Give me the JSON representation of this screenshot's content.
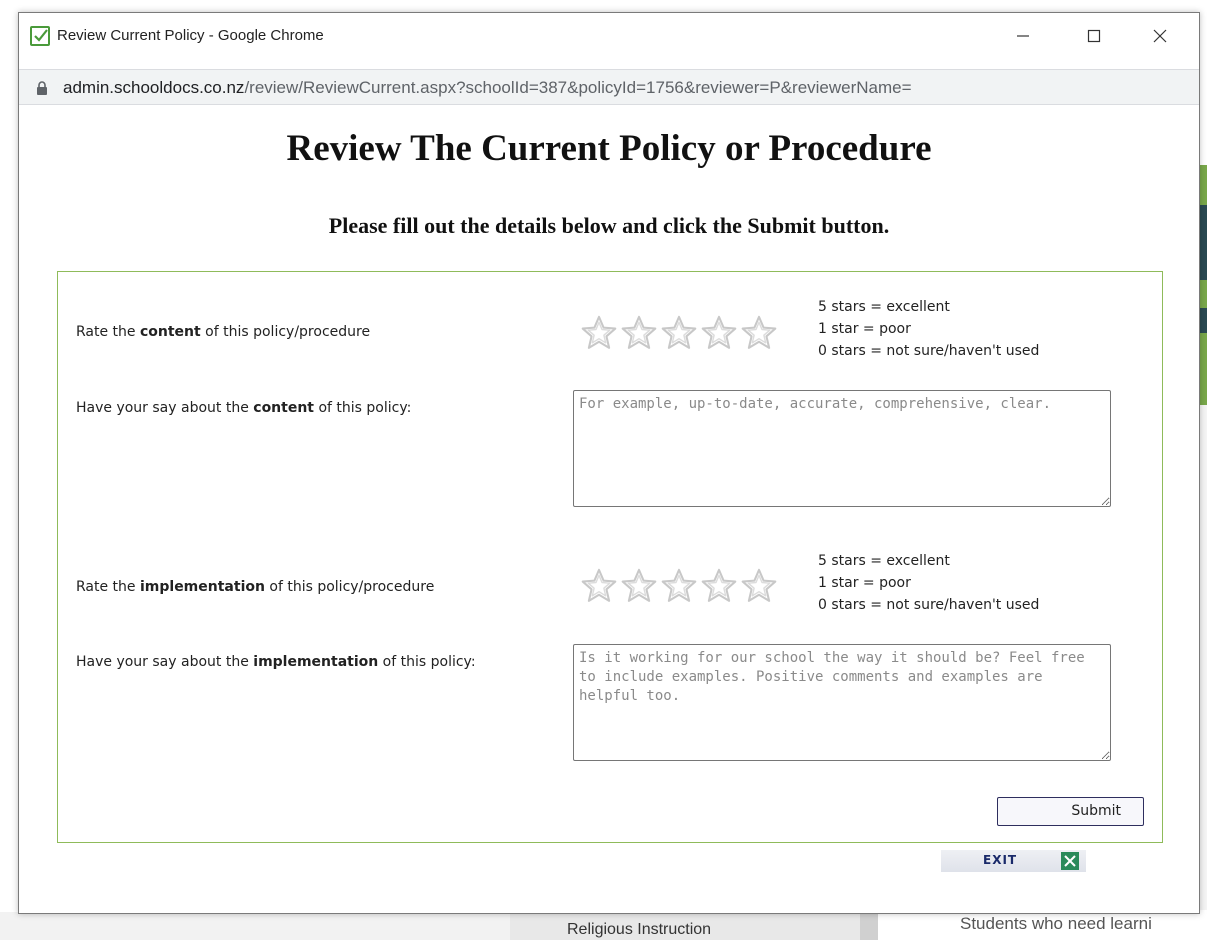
{
  "window": {
    "title": "Review Current Policy - Google Chrome",
    "url_host": "admin.schooldocs.co.nz",
    "url_path": "/review/ReviewCurrent.aspx?schoolId=387&policyId=1756&reviewer=P&reviewerName="
  },
  "page": {
    "heading": "Review The Current Policy or Procedure",
    "subheading": "Please fill out the details below and click the Submit button."
  },
  "form": {
    "content_rating": {
      "label_pre": "Rate the ",
      "label_bold": "content",
      "label_post": " of this policy/procedure",
      "stars_selected": 0,
      "stars_total": 5
    },
    "content_comment": {
      "label_pre": "Have your say about the ",
      "label_bold": "content",
      "label_post": " of this policy:",
      "placeholder": "For example, up-to-date, accurate, comprehensive, clear.",
      "value": ""
    },
    "implementation_rating": {
      "label_pre": "Rate the ",
      "label_bold": "implementation",
      "label_post": " of this policy/procedure",
      "stars_selected": 0,
      "stars_total": 5
    },
    "implementation_comment": {
      "label_pre": "Have your say about the ",
      "label_bold": "implementation",
      "label_post": " of this policy:",
      "placeholder": "Is it working for our school the way it should be? Feel free to include examples. Positive comments and examples are helpful too.",
      "value": ""
    },
    "legend": {
      "line1": "5 stars = excellent",
      "line2": "1 star = poor",
      "line3": "0 stars = not sure/haven't used"
    },
    "submit_label": "Submit",
    "exit_label": "EXIT"
  },
  "background": {
    "sidebar_item": "Religious Instruction",
    "partial_text": "Students who need learni"
  },
  "colors": {
    "form_border": "#8fbb5a",
    "check_icon": "#4a9a3a",
    "exit_icon": "#2a8a5a"
  },
  "icons": [
    "check-icon",
    "minimize-icon",
    "maximize-icon",
    "close-icon",
    "lock-icon",
    "star-icon",
    "exit-x-icon"
  ]
}
